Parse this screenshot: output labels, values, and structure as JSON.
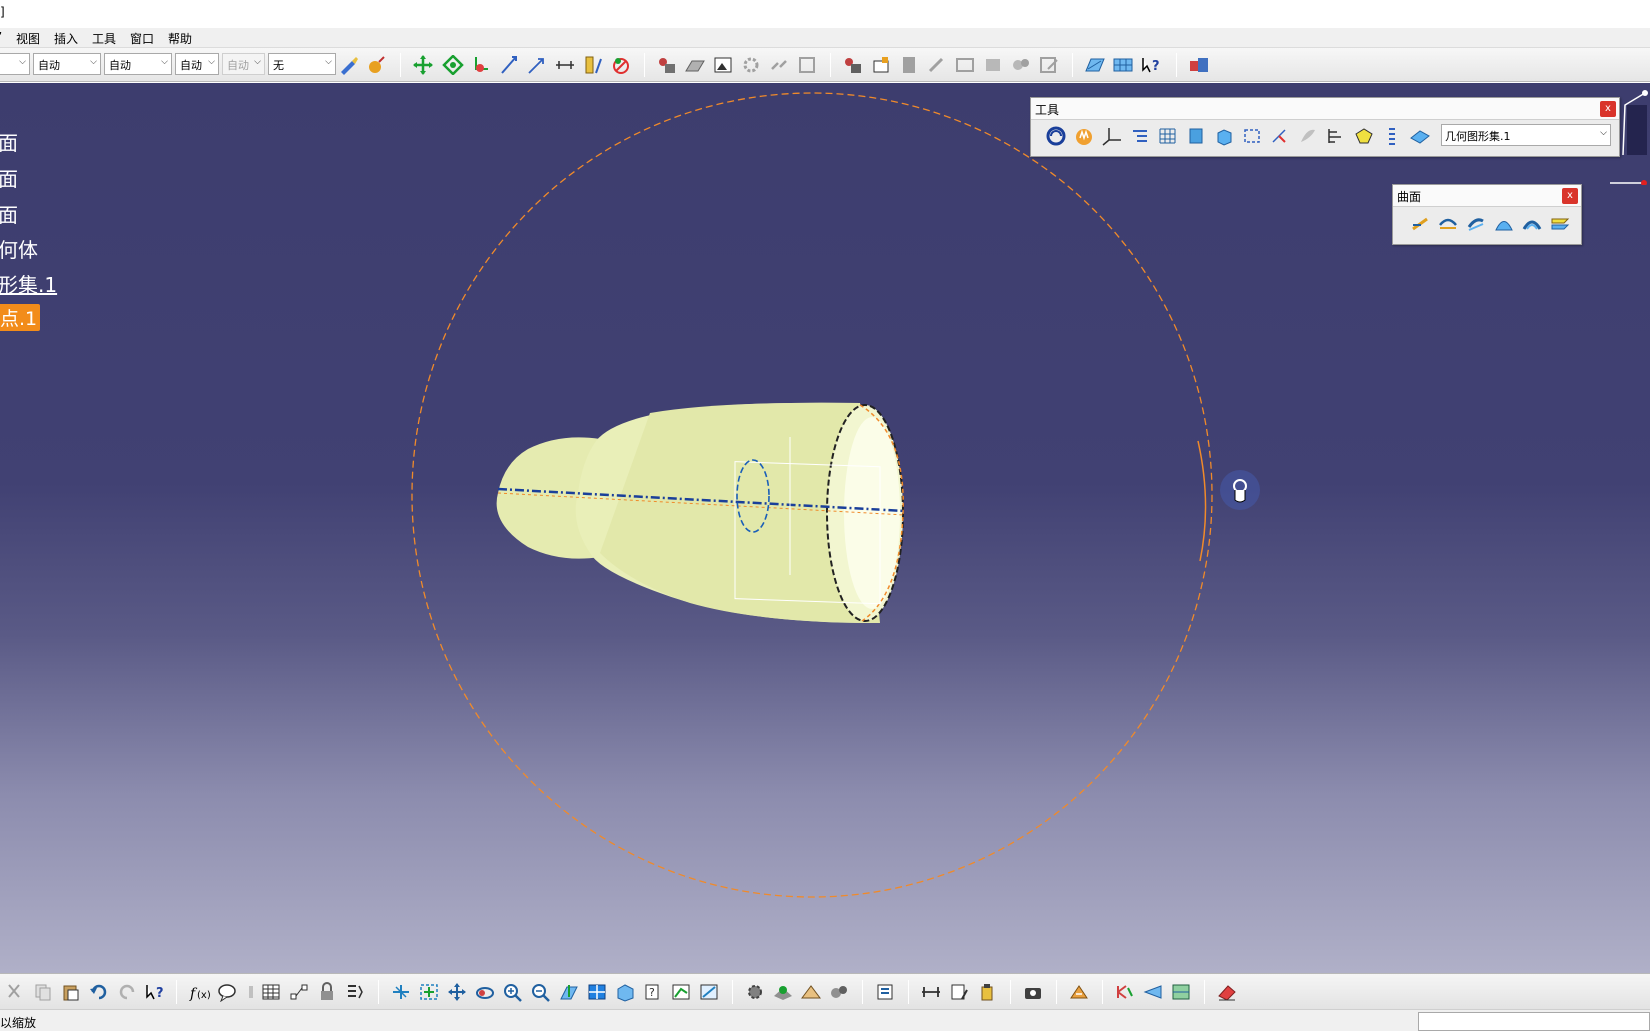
{
  "titlebar": {
    "text": "]"
  },
  "menu": {
    "items": [
      "”",
      "视图",
      "插入",
      "工具",
      "窗口",
      "帮助"
    ]
  },
  "toolbar_top": {
    "combo_1": "",
    "combo_2": "自动",
    "combo_3": "自动",
    "combo_4": "自动",
    "combo_5": "自动",
    "combo_6": "无"
  },
  "tree": {
    "items": [
      "面",
      "面",
      "面",
      "何体",
      "形集.1",
      "点.1"
    ]
  },
  "tools_panel": {
    "title": "工具",
    "close": "x",
    "geoset_select": "几何图形集.1"
  },
  "surface_panel": {
    "title": "曲面",
    "close": "x"
  },
  "statusbar": {
    "text": "以缩放"
  },
  "colors": {
    "viewport_top": "#3d3d6e",
    "model_fill": "#e6ecb0",
    "highlight": "#f28c1a",
    "close_red": "#d9342b"
  }
}
